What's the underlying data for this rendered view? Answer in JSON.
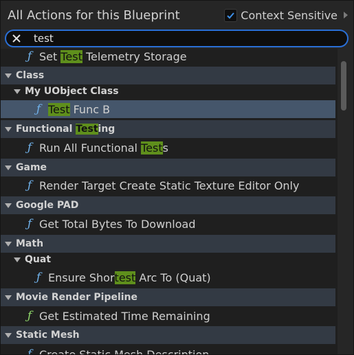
{
  "header": {
    "title": "All Actions for this Blueprint",
    "context_label": "Context Sensitive",
    "context_checked": true
  },
  "search": {
    "value": "test",
    "placeholder": ""
  },
  "rows": [
    {
      "kind": "fn",
      "text": "Set Test Telemetry Storage",
      "indent": 1,
      "icon": "function-icon"
    },
    {
      "kind": "cat",
      "text": "Class",
      "indent": 0
    },
    {
      "kind": "cat",
      "text": "My UObject Class",
      "indent": 1
    },
    {
      "kind": "fn",
      "text": "Test Func B",
      "indent": 2,
      "selected": true,
      "icon": "function-icon"
    },
    {
      "kind": "cat",
      "text": "Functional Testing",
      "indent": 0
    },
    {
      "kind": "fn",
      "text": "Run All Functional Tests",
      "indent": 1,
      "icon": "function-icon"
    },
    {
      "kind": "cat",
      "text": "Game",
      "indent": 0
    },
    {
      "kind": "fn",
      "text": "Render Target Create Static Texture Editor Only",
      "indent": 1,
      "icon": "function-icon"
    },
    {
      "kind": "cat",
      "text": "Google PAD",
      "indent": 0
    },
    {
      "kind": "fn",
      "text": "Get Total Bytes To Download",
      "indent": 1,
      "icon": "function-icon"
    },
    {
      "kind": "cat",
      "text": "Math",
      "indent": 0
    },
    {
      "kind": "cat",
      "text": "Quat",
      "indent": 1
    },
    {
      "kind": "fn",
      "text": "Ensure Shortest Arc To (Quat)",
      "indent": 2,
      "icon": "function-icon"
    },
    {
      "kind": "cat",
      "text": "Movie Render Pipeline",
      "indent": 0
    },
    {
      "kind": "fn",
      "text": "Get Estimated Time Remaining",
      "indent": 1,
      "icon": "function-pure-icon"
    },
    {
      "kind": "cat",
      "text": "Static Mesh",
      "indent": 0
    },
    {
      "kind": "fn",
      "text": "Create Static Mesh Description",
      "indent": 1,
      "icon": "function-icon"
    }
  ],
  "colors": {
    "accent": "#2a6fd6",
    "highlight": "#5f8f1c",
    "selected": "#45566b",
    "function_icon": "#6fb0e8",
    "pure_function_icon": "#8ed66a"
  }
}
